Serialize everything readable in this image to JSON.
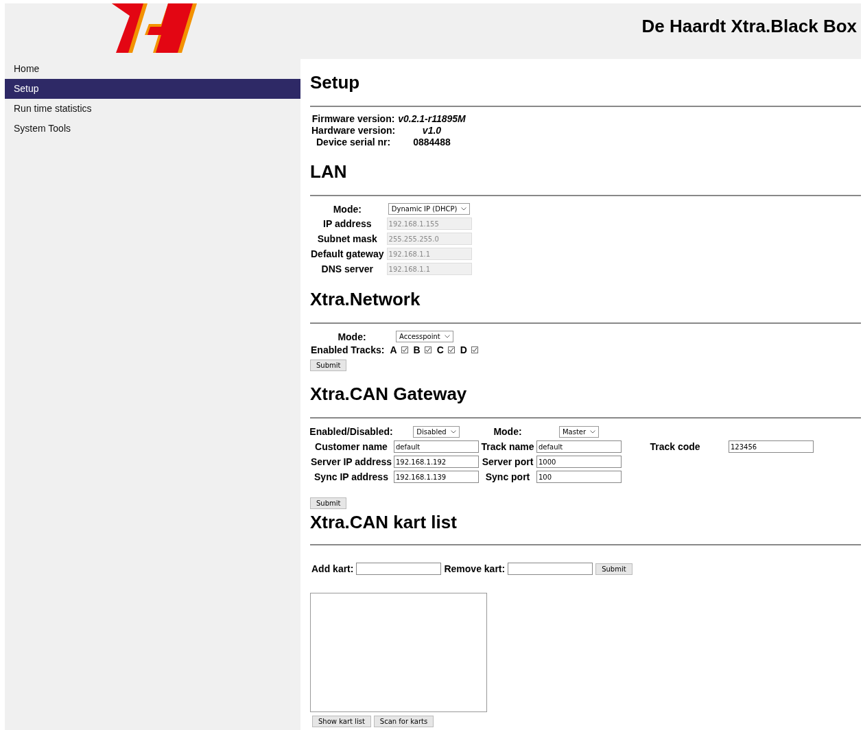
{
  "header": {
    "title": "De Haardt Xtra.Black Box"
  },
  "sidebar": {
    "items": [
      {
        "label": "Home",
        "selected": false
      },
      {
        "label": "Setup",
        "selected": true
      },
      {
        "label": "Run time statistics",
        "selected": false
      },
      {
        "label": "System Tools",
        "selected": false
      }
    ]
  },
  "page_title": "Setup",
  "info": [
    {
      "label": "Firmware version:",
      "value": "v0.2.1-r11895M",
      "kind": "version"
    },
    {
      "label": "Hardware version:",
      "value": "v1.0",
      "kind": "version"
    },
    {
      "label": "Device serial nr:",
      "value": "0884488",
      "kind": "serial"
    }
  ],
  "lan": {
    "heading": "LAN",
    "fields": [
      {
        "label": "Mode:",
        "kind": "select",
        "value": "Dynamic IP (DHCP)"
      },
      {
        "label": "IP address",
        "kind": "text",
        "value": "192.168.1.155",
        "disabled": true
      },
      {
        "label": "Subnet mask",
        "kind": "text",
        "value": "255.255.255.0",
        "disabled": true
      },
      {
        "label": "Default gateway",
        "kind": "text",
        "value": "192.168.1.1",
        "disabled": true
      },
      {
        "label": "DNS server",
        "kind": "text",
        "value": "192.168.1.1",
        "disabled": true
      }
    ]
  },
  "network": {
    "heading": "Xtra.Network",
    "mode": {
      "label": "Mode:",
      "value": "Accesspoint"
    },
    "tracks": {
      "label": "Enabled Tracks:",
      "items": [
        {
          "letter": "A",
          "checked": true
        },
        {
          "letter": "B",
          "checked": true
        },
        {
          "letter": "C",
          "checked": true
        },
        {
          "letter": "D",
          "checked": true
        }
      ]
    },
    "submit": "Submit"
  },
  "can_gateway": {
    "heading": "Xtra.CAN Gateway",
    "rows": [
      [
        {
          "kind": "label",
          "text": "Enabled/Disabled:"
        },
        {
          "kind": "select",
          "value": "Disabled"
        },
        {
          "kind": "label",
          "text": "Mode:"
        },
        {
          "kind": "select",
          "value": "Master"
        }
      ],
      [
        {
          "kind": "label",
          "text": "Customer name"
        },
        {
          "kind": "text",
          "value": "default"
        },
        {
          "kind": "label",
          "text": "Track name"
        },
        {
          "kind": "text",
          "value": "default"
        },
        {
          "kind": "label",
          "text": "Track code"
        },
        {
          "kind": "text",
          "value": "123456"
        }
      ],
      [
        {
          "kind": "label",
          "text": "Server IP address"
        },
        {
          "kind": "text",
          "value": "192.168.1.192"
        },
        {
          "kind": "label",
          "text": "Server port"
        },
        {
          "kind": "text",
          "value": "1000"
        }
      ],
      [
        {
          "kind": "label",
          "text": "Sync IP address"
        },
        {
          "kind": "text",
          "value": "192.168.1.139"
        },
        {
          "kind": "label",
          "text": "Sync port"
        },
        {
          "kind": "text",
          "value": "100"
        }
      ]
    ],
    "submit": "Submit"
  },
  "kart_list": {
    "heading": "Xtra.CAN kart list",
    "add_label": "Add kart:",
    "remove_label": "Remove kart:",
    "submit": "Submit",
    "buttons": [
      "Show kart list",
      "Scan for karts"
    ]
  }
}
